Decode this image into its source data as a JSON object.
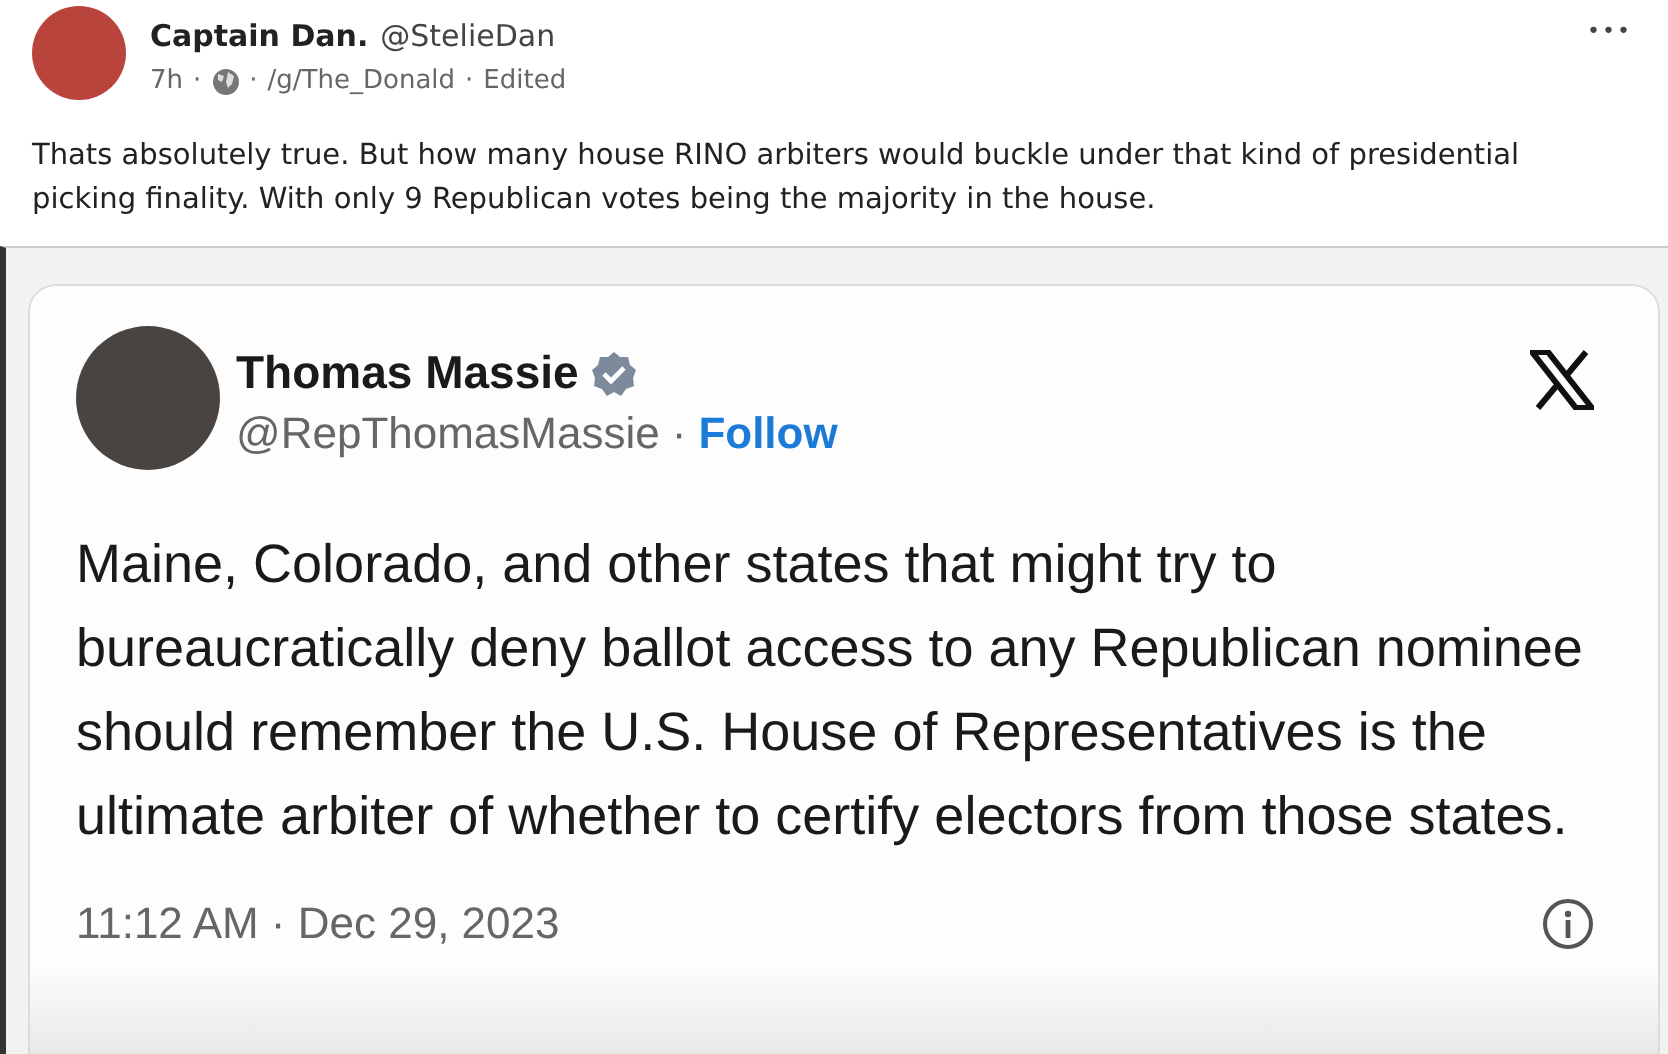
{
  "post": {
    "author": "Captain Dan.",
    "handle": "@StelieDan",
    "time": "7h",
    "separator": "·",
    "community": "/g/The_Donald",
    "status": "Edited",
    "menu": "•••",
    "text": "Thats absolutely true. But how many house RINO arbiters would buckle under that kind of presidential picking finality. With only 9 Republican votes being the majority in the house."
  },
  "embedded_tweet": {
    "author": "Thomas Massie",
    "verified": true,
    "handle": "@RepThomasMassie",
    "separator": "·",
    "follow": "Follow",
    "text": "Maine, Colorado, and other states that might try to bureaucratically deny ballot access to any Republican nominee should remember the U.S. House of Representatives is the ultimate arbiter of whether to certify electors from those states.",
    "timestamp": "11:12 AM · Dec 29, 2023"
  }
}
